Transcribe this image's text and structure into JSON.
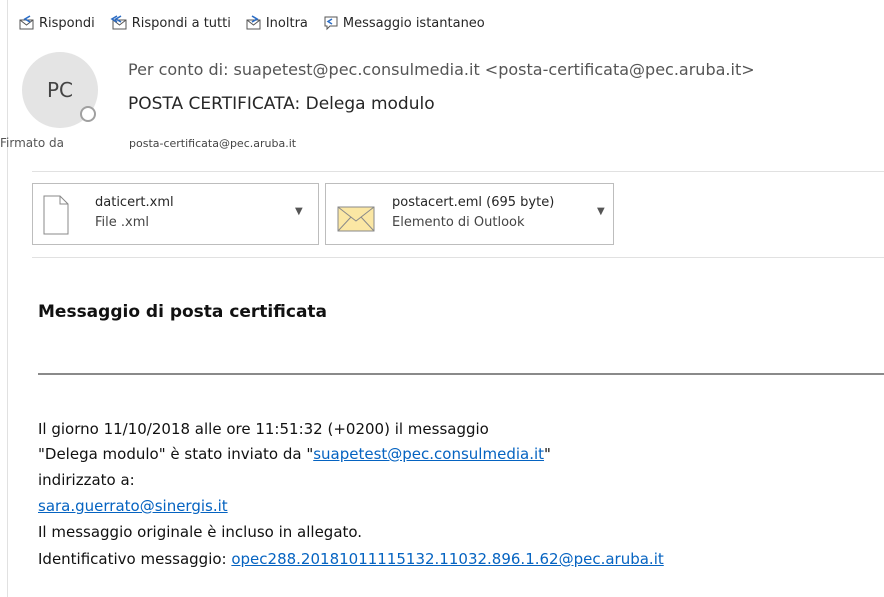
{
  "toolbar": {
    "reply": "Rispondi",
    "reply_all": "Rispondi a tutti",
    "forward": "Inoltra",
    "instant_message": "Messaggio istantaneo"
  },
  "header": {
    "avatar_initials": "PC",
    "sender": "Per conto di: suapetest@pec.consulmedia.it <posta-certificata@pec.aruba.it>",
    "subject": "POSTA CERTIFICATA: Delega modulo",
    "signed_label": "Firmato da",
    "signed_value": "posta-certificata@pec.aruba.it"
  },
  "attachments": [
    {
      "name": "daticert.xml",
      "type": "File .xml",
      "icon": "file-icon"
    },
    {
      "name": "postacert.eml (695 byte)",
      "type": "Elemento di Outlook",
      "icon": "envelope-icon"
    }
  ],
  "body": {
    "heading": "Messaggio di posta certificata",
    "line1": "Il giorno 11/10/2018 alle ore 11:51:32 (+0200) il messaggio",
    "line2_prefix": "\"Delega modulo\" è stato inviato da \"",
    "line2_link": "suapetest@pec.consulmedia.it",
    "line2_suffix": "\"",
    "line3": "indirizzato a:",
    "line4_link": "sara.guerrato@sinergis.it",
    "line5": "Il messaggio originale è incluso in allegato.",
    "line6_prefix": "Identificativo messaggio: ",
    "line6_link": "opec288.20181011115132.11032.896.1.62@pec.aruba.it"
  },
  "colors": {
    "link": "#0563c1",
    "icon_accent": "#2b6cc4",
    "envelope": "#fbe7a4"
  }
}
